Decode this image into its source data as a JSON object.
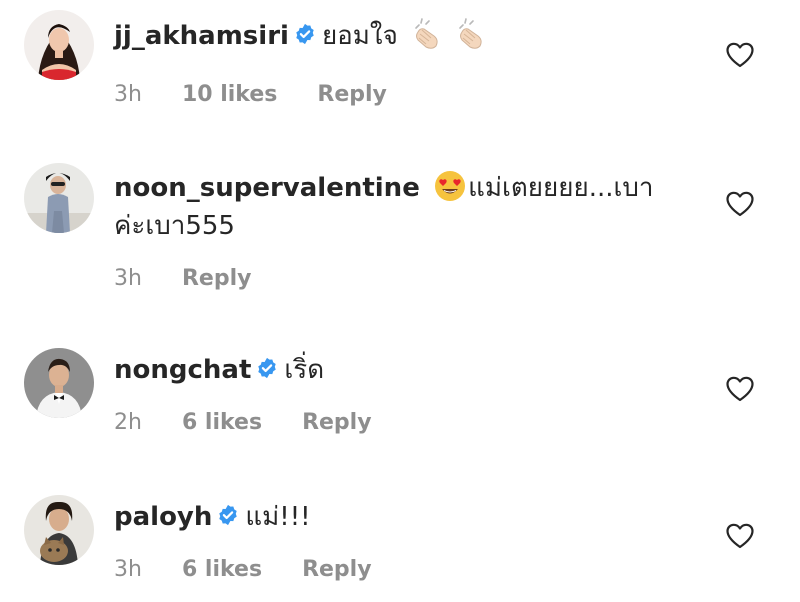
{
  "comments": [
    {
      "username": "jj_akhamsiri",
      "verified": true,
      "text": "ยอมใจ",
      "emoji": "clapping-hands-icon",
      "time": "3h",
      "likes": "10 likes",
      "reply": "Reply"
    },
    {
      "username": "noon_supervalentine",
      "verified": false,
      "text_line1": "แม่เตยยยย...เบา",
      "text_line2": "ค่ะเบา555",
      "emoji": "heart-eyes-face-icon",
      "time": "3h",
      "reply": "Reply"
    },
    {
      "username": "nongchat",
      "verified": true,
      "text": "เริ่ด",
      "time": "2h",
      "likes": "6 likes",
      "reply": "Reply"
    },
    {
      "username": "paloyh",
      "verified": true,
      "text": "แม่!!!",
      "time": "3h",
      "likes": "6 likes",
      "reply": "Reply"
    }
  ],
  "colors": {
    "text": "#262626",
    "meta": "#8e8e8e",
    "verified_badge": "#3897f0"
  }
}
